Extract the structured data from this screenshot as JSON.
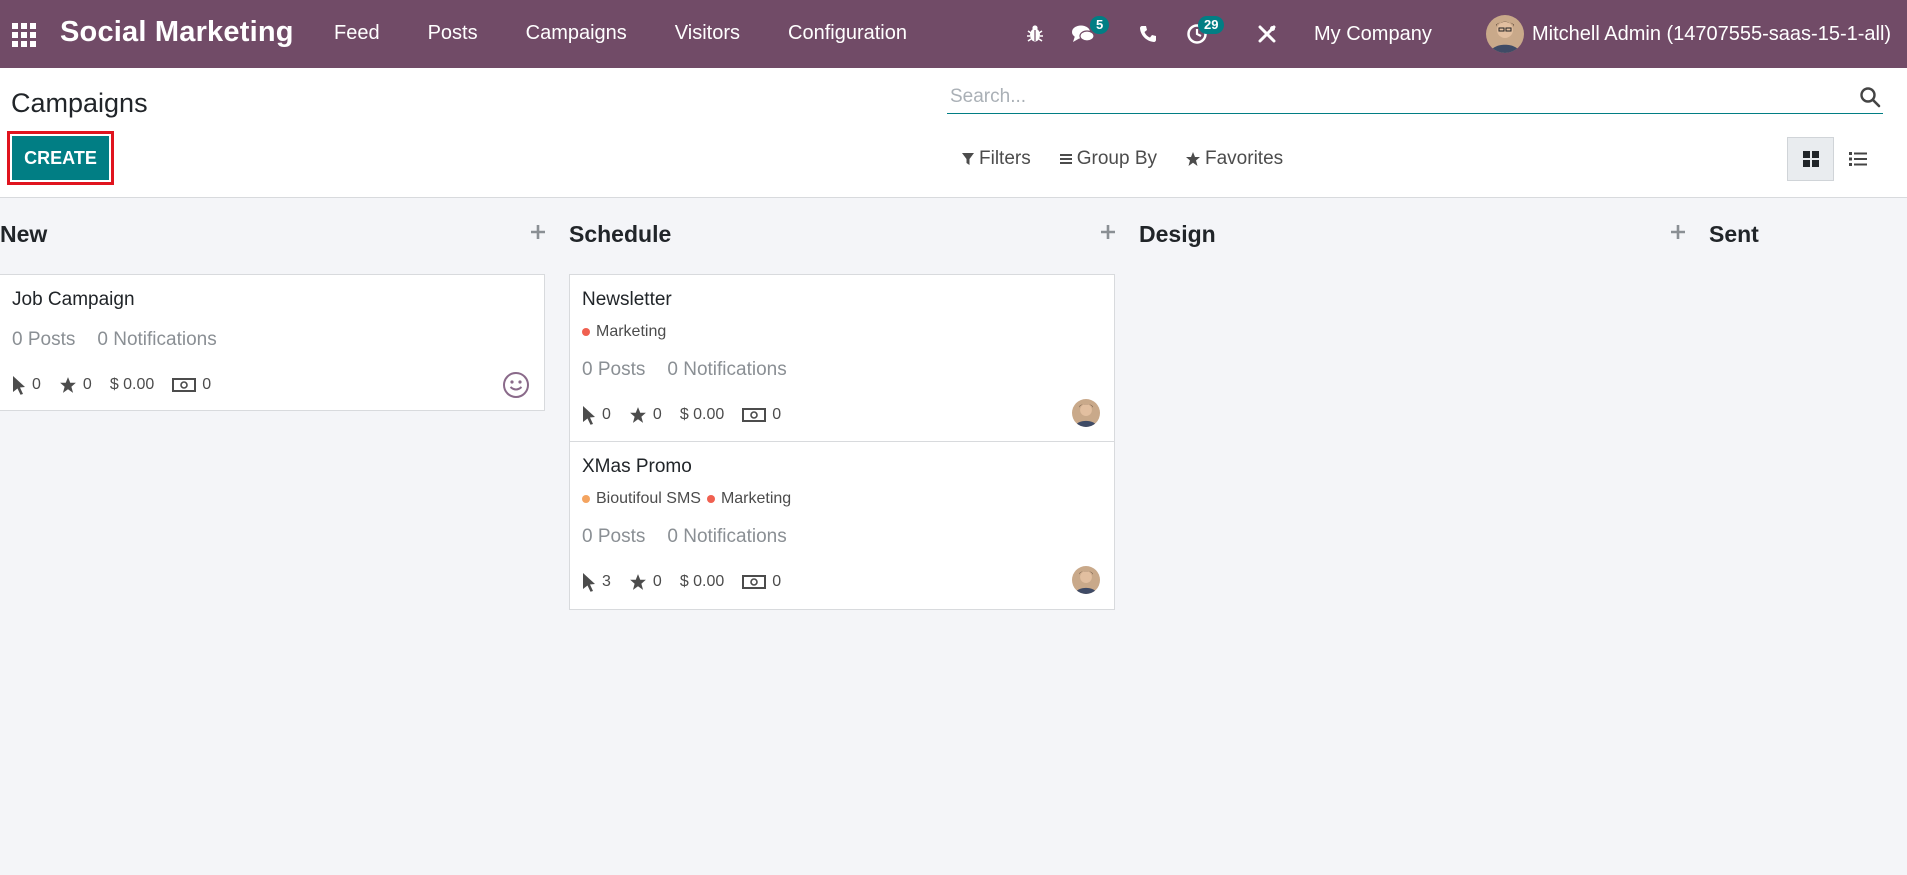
{
  "navbar": {
    "brand": "Social Marketing",
    "menu": [
      "Feed",
      "Posts",
      "Campaigns",
      "Visitors",
      "Configuration"
    ],
    "messages_badge": "5",
    "activities_badge": "29",
    "company": "My Company",
    "user": "Mitchell Admin (14707555-saas-15-1-all)"
  },
  "control_panel": {
    "title": "Campaigns",
    "create_label": "CREATE",
    "search_placeholder": "Search...",
    "filters_label": "Filters",
    "group_by_label": "Group By",
    "favorites_label": "Favorites"
  },
  "kanban": {
    "columns": [
      {
        "name": "New"
      },
      {
        "name": "Schedule"
      },
      {
        "name": "Design"
      },
      {
        "name": "Sent"
      }
    ],
    "cards": [
      {
        "title": "Job Campaign",
        "posts": "0 Posts",
        "notifications": "0 Notifications",
        "clicks": "0",
        "stars": "0",
        "revenue": "$ 0.00",
        "money": "0"
      },
      {
        "title": "Newsletter",
        "tags": [
          {
            "label": "Marketing",
            "color": "#f06050"
          }
        ],
        "posts": "0 Posts",
        "notifications": "0 Notifications",
        "clicks": "0",
        "stars": "0",
        "revenue": "$ 0.00",
        "money": "0"
      },
      {
        "title": "XMas Promo",
        "tags": [
          {
            "label": "Bioutifoul SMS",
            "color": "#f4a460"
          },
          {
            "label": "Marketing",
            "color": "#f06050"
          }
        ],
        "posts": "0 Posts",
        "notifications": "0 Notifications",
        "clicks": "3",
        "stars": "0",
        "revenue": "$ 0.00",
        "money": "0"
      }
    ]
  },
  "colors": {
    "navbar": "#714b67",
    "primary": "#017e84",
    "highlight": "#e0141e"
  },
  "icons": [
    "apps-grid-icon",
    "bug-icon",
    "chat-icon",
    "phone-icon",
    "activity-clock-icon",
    "tools-icon",
    "search-icon",
    "filter-icon",
    "group-by-icon",
    "star-icon",
    "kanban-view-icon",
    "list-view-icon",
    "plus-icon",
    "cursor-icon",
    "money-icon",
    "smiley-icon"
  ]
}
